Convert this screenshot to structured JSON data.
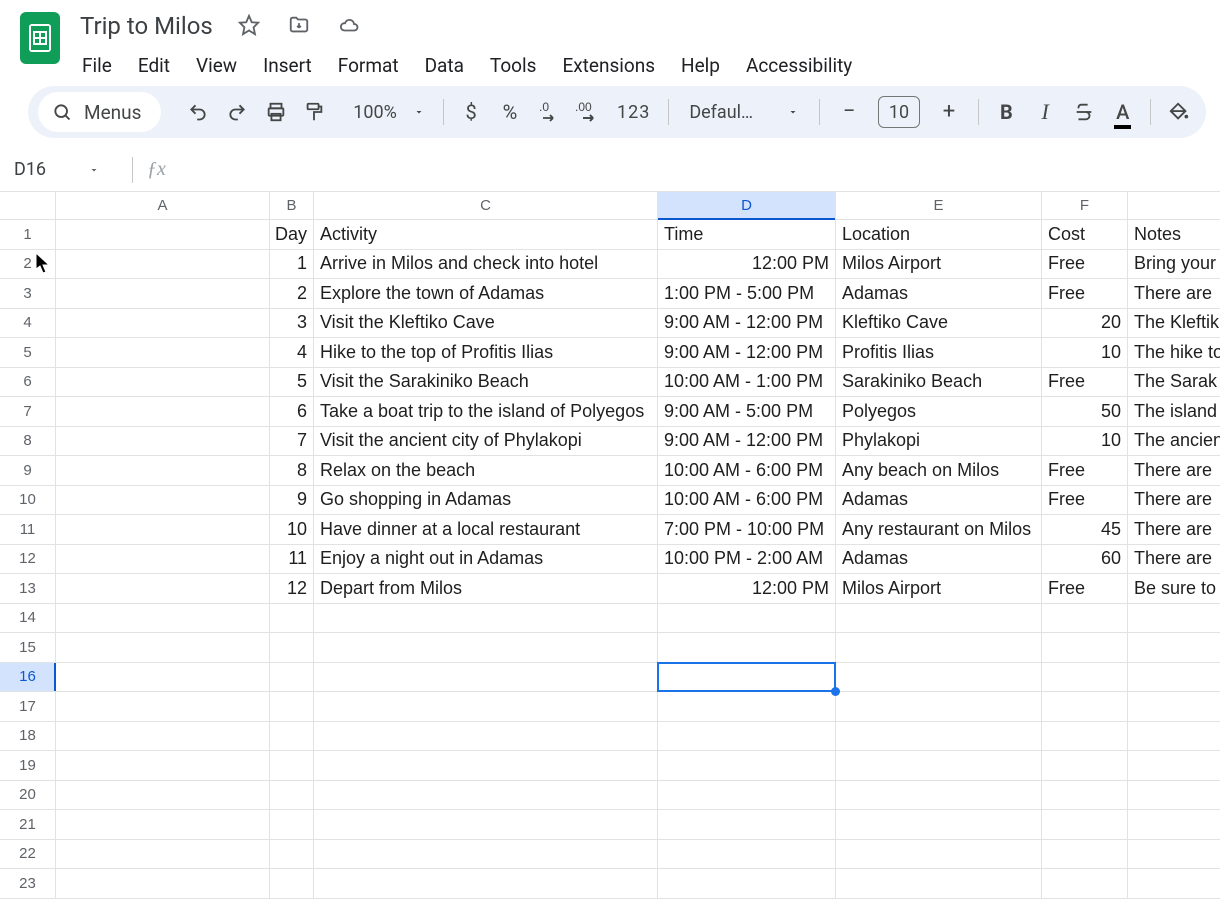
{
  "doc": {
    "title": "Trip to Milos"
  },
  "menubar": [
    "File",
    "Edit",
    "View",
    "Insert",
    "Format",
    "Data",
    "Tools",
    "Extensions",
    "Help",
    "Accessibility"
  ],
  "toolbar": {
    "search_label": "Menus",
    "zoom": "100%",
    "number_label": "123",
    "font": "Defaul…",
    "font_size": "10"
  },
  "namebox": "D16",
  "columns": [
    "A",
    "B",
    "C",
    "D",
    "E",
    "F"
  ],
  "row_count": 23,
  "selected": {
    "col_index": 3,
    "row_index": 15
  },
  "headers": {
    "B": "Day",
    "C": "Activity",
    "D": "Time",
    "E": "Location",
    "F": "Cost",
    "G": "Notes"
  },
  "data_rows": [
    {
      "day": "1",
      "activity": "Arrive in Milos and check into hotel",
      "time": "12:00 PM",
      "location": "Milos Airport",
      "cost": "Free",
      "notes": "Bring your"
    },
    {
      "day": "2",
      "activity": "Explore the town of Adamas",
      "time": "1:00 PM - 5:00 PM",
      "location": "Adamas",
      "cost": "Free",
      "notes": "There are"
    },
    {
      "day": "3",
      "activity": "Visit the Kleftiko Cave",
      "time": "9:00 AM - 12:00 PM",
      "location": "Kleftiko Cave",
      "cost": "20",
      "notes": "The Kleftik"
    },
    {
      "day": "4",
      "activity": "Hike to the top of Profitis Ilias",
      "time": "9:00 AM - 12:00 PM",
      "location": "Profitis Ilias",
      "cost": "10",
      "notes": "The hike to"
    },
    {
      "day": "5",
      "activity": "Visit the Sarakiniko Beach",
      "time": "10:00 AM - 1:00 PM",
      "location": "Sarakiniko Beach",
      "cost": "Free",
      "notes": "The Sarak"
    },
    {
      "day": "6",
      "activity": "Take a boat trip to the island of Polyegos",
      "time": "9:00 AM - 5:00 PM",
      "location": "Polyegos",
      "cost": "50",
      "notes": "The island"
    },
    {
      "day": "7",
      "activity": "Visit the ancient city of Phylakopi",
      "time": "9:00 AM - 12:00 PM",
      "location": "Phylakopi",
      "cost": "10",
      "notes": "The ancien"
    },
    {
      "day": "8",
      "activity": "Relax on the beach",
      "time": "10:00 AM - 6:00 PM",
      "location": "Any beach on Milos",
      "cost": "Free",
      "notes": "There are"
    },
    {
      "day": "9",
      "activity": "Go shopping in Adamas",
      "time": "10:00 AM - 6:00 PM",
      "location": "Adamas",
      "cost": "Free",
      "notes": "There are"
    },
    {
      "day": "10",
      "activity": "Have dinner at a local restaurant",
      "time": "7:00 PM - 10:00 PM",
      "location": "Any restaurant on Milos",
      "cost": "45",
      "notes": "There are"
    },
    {
      "day": "11",
      "activity": "Enjoy a night out in Adamas",
      "time": "10:00 PM - 2:00 AM",
      "location": "Adamas",
      "cost": "60",
      "notes": "There are"
    },
    {
      "day": "12",
      "activity": "Depart from Milos",
      "time": "12:00 PM",
      "location": "Milos Airport",
      "cost": "Free",
      "notes": "Be sure to"
    }
  ]
}
